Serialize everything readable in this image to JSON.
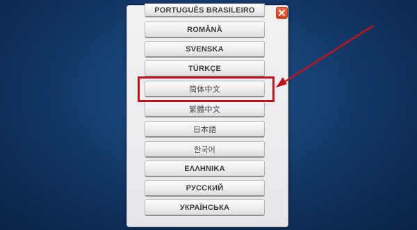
{
  "dialog": {
    "languages": [
      "PORTUGUÊS BRASILEIRO",
      "ROMÂNĂ",
      "SVENSKA",
      "TÜRKÇE",
      "简体中文",
      "繁體中文",
      "日本語",
      "한국어",
      "ΕΛΛΗΝΙΚΑ",
      "РУССКИЙ",
      "УКРАЇНСЬКА"
    ],
    "close_icon": "close-x-icon"
  },
  "annotation": {
    "highlighted_language": "简体中文",
    "highlight_color": "#c0121a"
  },
  "colors": {
    "background": "#163e70",
    "panel": "#efeef2",
    "close_button": "#e5532d"
  }
}
